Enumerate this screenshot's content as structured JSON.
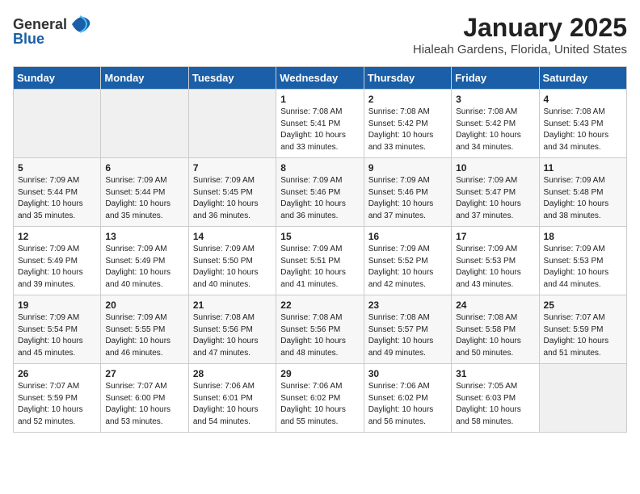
{
  "header": {
    "logo_general": "General",
    "logo_blue": "Blue",
    "title": "January 2025",
    "subtitle": "Hialeah Gardens, Florida, United States"
  },
  "weekdays": [
    "Sunday",
    "Monday",
    "Tuesday",
    "Wednesday",
    "Thursday",
    "Friday",
    "Saturday"
  ],
  "weeks": [
    [
      {
        "day": "",
        "sunrise": "",
        "sunset": "",
        "daylight": "",
        "empty": true
      },
      {
        "day": "",
        "sunrise": "",
        "sunset": "",
        "daylight": "",
        "empty": true
      },
      {
        "day": "",
        "sunrise": "",
        "sunset": "",
        "daylight": "",
        "empty": true
      },
      {
        "day": "1",
        "sunrise": "7:08 AM",
        "sunset": "5:41 PM",
        "daylight": "10 hours and 33 minutes."
      },
      {
        "day": "2",
        "sunrise": "7:08 AM",
        "sunset": "5:42 PM",
        "daylight": "10 hours and 33 minutes."
      },
      {
        "day": "3",
        "sunrise": "7:08 AM",
        "sunset": "5:42 PM",
        "daylight": "10 hours and 34 minutes."
      },
      {
        "day": "4",
        "sunrise": "7:08 AM",
        "sunset": "5:43 PM",
        "daylight": "10 hours and 34 minutes."
      }
    ],
    [
      {
        "day": "5",
        "sunrise": "7:09 AM",
        "sunset": "5:44 PM",
        "daylight": "10 hours and 35 minutes."
      },
      {
        "day": "6",
        "sunrise": "7:09 AM",
        "sunset": "5:44 PM",
        "daylight": "10 hours and 35 minutes."
      },
      {
        "day": "7",
        "sunrise": "7:09 AM",
        "sunset": "5:45 PM",
        "daylight": "10 hours and 36 minutes."
      },
      {
        "day": "8",
        "sunrise": "7:09 AM",
        "sunset": "5:46 PM",
        "daylight": "10 hours and 36 minutes."
      },
      {
        "day": "9",
        "sunrise": "7:09 AM",
        "sunset": "5:46 PM",
        "daylight": "10 hours and 37 minutes."
      },
      {
        "day": "10",
        "sunrise": "7:09 AM",
        "sunset": "5:47 PM",
        "daylight": "10 hours and 37 minutes."
      },
      {
        "day": "11",
        "sunrise": "7:09 AM",
        "sunset": "5:48 PM",
        "daylight": "10 hours and 38 minutes."
      }
    ],
    [
      {
        "day": "12",
        "sunrise": "7:09 AM",
        "sunset": "5:49 PM",
        "daylight": "10 hours and 39 minutes."
      },
      {
        "day": "13",
        "sunrise": "7:09 AM",
        "sunset": "5:49 PM",
        "daylight": "10 hours and 40 minutes."
      },
      {
        "day": "14",
        "sunrise": "7:09 AM",
        "sunset": "5:50 PM",
        "daylight": "10 hours and 40 minutes."
      },
      {
        "day": "15",
        "sunrise": "7:09 AM",
        "sunset": "5:51 PM",
        "daylight": "10 hours and 41 minutes."
      },
      {
        "day": "16",
        "sunrise": "7:09 AM",
        "sunset": "5:52 PM",
        "daylight": "10 hours and 42 minutes."
      },
      {
        "day": "17",
        "sunrise": "7:09 AM",
        "sunset": "5:53 PM",
        "daylight": "10 hours and 43 minutes."
      },
      {
        "day": "18",
        "sunrise": "7:09 AM",
        "sunset": "5:53 PM",
        "daylight": "10 hours and 44 minutes."
      }
    ],
    [
      {
        "day": "19",
        "sunrise": "7:09 AM",
        "sunset": "5:54 PM",
        "daylight": "10 hours and 45 minutes."
      },
      {
        "day": "20",
        "sunrise": "7:09 AM",
        "sunset": "5:55 PM",
        "daylight": "10 hours and 46 minutes."
      },
      {
        "day": "21",
        "sunrise": "7:08 AM",
        "sunset": "5:56 PM",
        "daylight": "10 hours and 47 minutes."
      },
      {
        "day": "22",
        "sunrise": "7:08 AM",
        "sunset": "5:56 PM",
        "daylight": "10 hours and 48 minutes."
      },
      {
        "day": "23",
        "sunrise": "7:08 AM",
        "sunset": "5:57 PM",
        "daylight": "10 hours and 49 minutes."
      },
      {
        "day": "24",
        "sunrise": "7:08 AM",
        "sunset": "5:58 PM",
        "daylight": "10 hours and 50 minutes."
      },
      {
        "day": "25",
        "sunrise": "7:07 AM",
        "sunset": "5:59 PM",
        "daylight": "10 hours and 51 minutes."
      }
    ],
    [
      {
        "day": "26",
        "sunrise": "7:07 AM",
        "sunset": "5:59 PM",
        "daylight": "10 hours and 52 minutes."
      },
      {
        "day": "27",
        "sunrise": "7:07 AM",
        "sunset": "6:00 PM",
        "daylight": "10 hours and 53 minutes."
      },
      {
        "day": "28",
        "sunrise": "7:06 AM",
        "sunset": "6:01 PM",
        "daylight": "10 hours and 54 minutes."
      },
      {
        "day": "29",
        "sunrise": "7:06 AM",
        "sunset": "6:02 PM",
        "daylight": "10 hours and 55 minutes."
      },
      {
        "day": "30",
        "sunrise": "7:06 AM",
        "sunset": "6:02 PM",
        "daylight": "10 hours and 56 minutes."
      },
      {
        "day": "31",
        "sunrise": "7:05 AM",
        "sunset": "6:03 PM",
        "daylight": "10 hours and 58 minutes."
      },
      {
        "day": "",
        "sunrise": "",
        "sunset": "",
        "daylight": "",
        "empty": true
      }
    ]
  ]
}
